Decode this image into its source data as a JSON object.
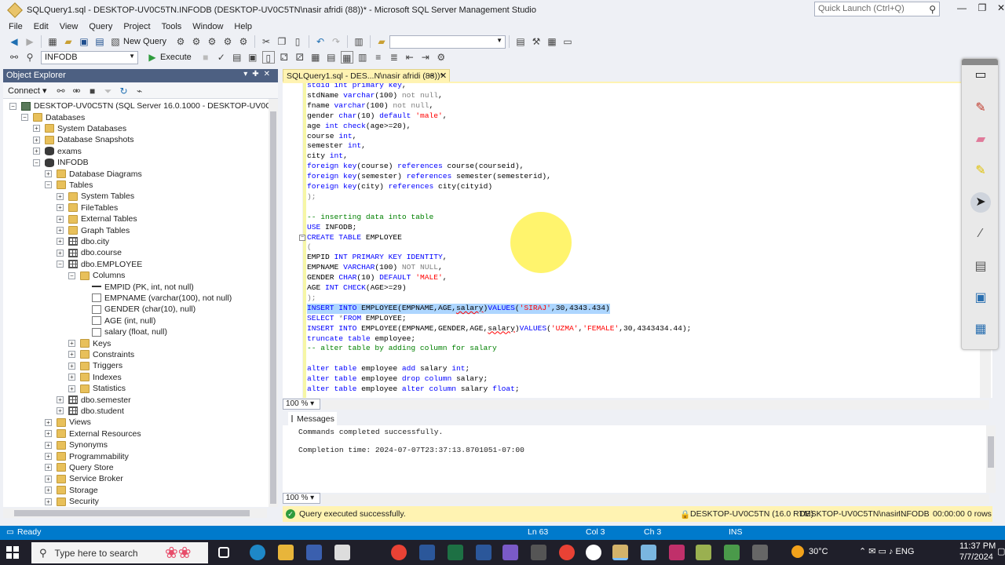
{
  "window": {
    "title": "SQLQuery1.sql - DESKTOP-UV0C5TN.INFODB (DESKTOP-UV0C5TN\\nasir afridi (88))* - Microsoft SQL Server Management Studio",
    "quick_launch_placeholder": "Quick Launch (Ctrl+Q)"
  },
  "menu": [
    "File",
    "Edit",
    "View",
    "Query",
    "Project",
    "Tools",
    "Window",
    "Help"
  ],
  "toolbar": {
    "new_query": "New Query",
    "database": "INFODB",
    "execute": "Execute"
  },
  "object_explorer": {
    "title": "Object Explorer",
    "connect": "Connect",
    "tree": [
      {
        "label": "DESKTOP-UV0C5TN (SQL Server 16.0.1000 - DESKTOP-UV0C5TN\\nasir a",
        "level": 0,
        "state": "-",
        "icon": "server"
      },
      {
        "label": "Databases",
        "level": 1,
        "state": "-",
        "icon": "folder"
      },
      {
        "label": "System Databases",
        "level": 2,
        "state": "+",
        "icon": "folder"
      },
      {
        "label": "Database Snapshots",
        "level": 2,
        "state": "+",
        "icon": "folder"
      },
      {
        "label": "exams",
        "level": 2,
        "state": "+",
        "icon": "db"
      },
      {
        "label": "INFODB",
        "level": 2,
        "state": "-",
        "icon": "db"
      },
      {
        "label": "Database Diagrams",
        "level": 3,
        "state": "+",
        "icon": "folder"
      },
      {
        "label": "Tables",
        "level": 3,
        "state": "-",
        "icon": "folder"
      },
      {
        "label": "System Tables",
        "level": 4,
        "state": "+",
        "icon": "folder"
      },
      {
        "label": "FileTables",
        "level": 4,
        "state": "+",
        "icon": "folder"
      },
      {
        "label": "External Tables",
        "level": 4,
        "state": "+",
        "icon": "folder"
      },
      {
        "label": "Graph Tables",
        "level": 4,
        "state": "+",
        "icon": "folder"
      },
      {
        "label": "dbo.city",
        "level": 4,
        "state": "+",
        "icon": "table"
      },
      {
        "label": "dbo.course",
        "level": 4,
        "state": "+",
        "icon": "table"
      },
      {
        "label": "dbo.EMPLOYEE",
        "level": 4,
        "state": "-",
        "icon": "table"
      },
      {
        "label": "Columns",
        "level": 5,
        "state": "-",
        "icon": "folder"
      },
      {
        "label": "EMPID (PK, int, not null)",
        "level": 6,
        "state": "",
        "icon": "key"
      },
      {
        "label": "EMPNAME (varchar(100), not null)",
        "level": 6,
        "state": "",
        "icon": "col"
      },
      {
        "label": "GENDER (char(10), null)",
        "level": 6,
        "state": "",
        "icon": "col"
      },
      {
        "label": "AGE (int, null)",
        "level": 6,
        "state": "",
        "icon": "col"
      },
      {
        "label": "salary (float, null)",
        "level": 6,
        "state": "",
        "icon": "col"
      },
      {
        "label": "Keys",
        "level": 5,
        "state": "+",
        "icon": "folder"
      },
      {
        "label": "Constraints",
        "level": 5,
        "state": "+",
        "icon": "folder"
      },
      {
        "label": "Triggers",
        "level": 5,
        "state": "+",
        "icon": "folder"
      },
      {
        "label": "Indexes",
        "level": 5,
        "state": "+",
        "icon": "folder"
      },
      {
        "label": "Statistics",
        "level": 5,
        "state": "+",
        "icon": "folder"
      },
      {
        "label": "dbo.semester",
        "level": 4,
        "state": "+",
        "icon": "table"
      },
      {
        "label": "dbo.student",
        "level": 4,
        "state": "+",
        "icon": "table"
      },
      {
        "label": "Views",
        "level": 3,
        "state": "+",
        "icon": "folder"
      },
      {
        "label": "External Resources",
        "level": 3,
        "state": "+",
        "icon": "folder"
      },
      {
        "label": "Synonyms",
        "level": 3,
        "state": "+",
        "icon": "folder"
      },
      {
        "label": "Programmability",
        "level": 3,
        "state": "+",
        "icon": "folder"
      },
      {
        "label": "Query Store",
        "level": 3,
        "state": "+",
        "icon": "folder"
      },
      {
        "label": "Service Broker",
        "level": 3,
        "state": "+",
        "icon": "folder"
      },
      {
        "label": "Storage",
        "level": 3,
        "state": "+",
        "icon": "folder"
      },
      {
        "label": "Security",
        "level": 3,
        "state": "+",
        "icon": "folder"
      }
    ]
  },
  "editor": {
    "tab_title": "SQLQuery1.sql - DES...N\\nasir afridi (88))*",
    "zoom": "100 %",
    "lines": [
      [
        [
          "kw",
          "stdid int primary key"
        ],
        [
          "",
          ","
        ]
      ],
      [
        [
          "",
          "stdName "
        ],
        [
          "kw",
          "varchar"
        ],
        [
          "",
          "(100) "
        ],
        [
          "gr",
          "not null"
        ],
        [
          "",
          ","
        ]
      ],
      [
        [
          "",
          "fname "
        ],
        [
          "kw",
          "varchar"
        ],
        [
          "",
          "(100) "
        ],
        [
          "gr",
          "not null"
        ],
        [
          "",
          ","
        ]
      ],
      [
        [
          "",
          "gender "
        ],
        [
          "kw",
          "char"
        ],
        [
          "",
          "(10) "
        ],
        [
          "kw",
          "default "
        ],
        [
          "str",
          "'male'"
        ],
        [
          "",
          ","
        ]
      ],
      [
        [
          "",
          "age "
        ],
        [
          "kw",
          "int check"
        ],
        [
          "",
          "(age>=20),"
        ]
      ],
      [
        [
          "",
          "course "
        ],
        [
          "kw",
          "int"
        ],
        [
          "",
          ","
        ]
      ],
      [
        [
          "",
          "semester "
        ],
        [
          "kw",
          "int"
        ],
        [
          "",
          ","
        ]
      ],
      [
        [
          "",
          "city "
        ],
        [
          "kw",
          "int"
        ],
        [
          "",
          ","
        ]
      ],
      [
        [
          "kw",
          "foreign key"
        ],
        [
          "",
          "(course) "
        ],
        [
          "kw",
          "references "
        ],
        [
          "",
          "course(courseid),"
        ]
      ],
      [
        [
          "kw",
          "foreign key"
        ],
        [
          "",
          "(semester) "
        ],
        [
          "kw",
          "references "
        ],
        [
          "",
          "semester(semesterid),"
        ]
      ],
      [
        [
          "kw",
          "foreign key"
        ],
        [
          "",
          "(city) "
        ],
        [
          "kw",
          "references "
        ],
        [
          "",
          "city(cityid)"
        ]
      ],
      [
        [
          "gr",
          ");"
        ]
      ],
      [
        [
          "",
          ""
        ]
      ],
      [
        [
          "cm",
          "-- inserting data into table"
        ]
      ],
      [
        [
          "kw",
          "USE "
        ],
        [
          "",
          "INFODB;"
        ]
      ],
      [
        [
          "kw",
          "CREATE TABLE "
        ],
        [
          "",
          "EMPLOYEE"
        ]
      ],
      [
        [
          "gr",
          "("
        ]
      ],
      [
        [
          "",
          "EMPID "
        ],
        [
          "kw",
          "INT PRIMARY KEY IDENTITY"
        ],
        [
          "",
          ","
        ]
      ],
      [
        [
          "",
          "EMPNAME "
        ],
        [
          "kw",
          "VARCHAR"
        ],
        [
          "",
          "(100) "
        ],
        [
          "gr",
          "NOT NULL"
        ],
        [
          "",
          ","
        ]
      ],
      [
        [
          "",
          "GENDER "
        ],
        [
          "kw",
          "CHAR"
        ],
        [
          "",
          "(10) "
        ],
        [
          "kw",
          "DEFAULT "
        ],
        [
          "str",
          "'MALE'"
        ],
        [
          "",
          ","
        ]
      ],
      [
        [
          "",
          "AGE "
        ],
        [
          "kw",
          "INT CHECK"
        ],
        [
          "",
          "(AGE>=29)"
        ]
      ],
      [
        [
          "gr",
          ");"
        ]
      ],
      [
        [
          "kw",
          "INSERT INTO "
        ],
        [
          "",
          "EMPLOYEE(EMPNAME,AGE,"
        ],
        [
          "squig",
          "salary"
        ],
        [
          "",
          ")"
        ],
        [
          "kw",
          "VALUES"
        ],
        [
          "",
          "("
        ],
        [
          "str",
          "'SIRAJ'"
        ],
        [
          "",
          ",30,4343.434)"
        ]
      ],
      [
        [
          "kw",
          "SELECT "
        ],
        [
          "gr",
          "*"
        ],
        [
          "kw",
          "FROM "
        ],
        [
          "",
          "EMPLOYEE;"
        ]
      ],
      [
        [
          "kw",
          "INSERT INTO "
        ],
        [
          "",
          "EMPLOYEE(EMPNAME,GENDER,AGE,"
        ],
        [
          "squig",
          "salary"
        ],
        [
          "",
          ")"
        ],
        [
          "kw",
          "VALUES"
        ],
        [
          "",
          "("
        ],
        [
          "str",
          "'UZMA'"
        ],
        [
          "",
          ","
        ],
        [
          "str",
          "'FEMALE'"
        ],
        [
          "",
          ",30,4343434.44);"
        ]
      ],
      [
        [
          "kw",
          "truncate table "
        ],
        [
          "",
          "employee;"
        ]
      ],
      [
        [
          "cm",
          "-- alter table by adding column for salary"
        ]
      ],
      [
        [
          "",
          ""
        ]
      ],
      [
        [
          "kw",
          "alter table "
        ],
        [
          "",
          "employee "
        ],
        [
          "kw",
          "add "
        ],
        [
          "",
          "salary "
        ],
        [
          "kw",
          "int"
        ],
        [
          "",
          ";"
        ]
      ],
      [
        [
          "kw",
          "alter table "
        ],
        [
          "",
          "employee "
        ],
        [
          "kw",
          "drop column "
        ],
        [
          "",
          "salary;"
        ]
      ],
      [
        [
          "kw",
          "alter table "
        ],
        [
          "",
          "employee "
        ],
        [
          "kw",
          "alter column "
        ],
        [
          "",
          "salary "
        ],
        [
          "kw",
          "float"
        ],
        [
          "",
          ";"
        ]
      ]
    ]
  },
  "results": {
    "tab": "Messages",
    "zoom": "100 %",
    "line1": "Commands completed successfully.",
    "line2": "Completion time: 2024-07-07T23:37:13.8701051-07:00"
  },
  "query_status": {
    "message": "Query executed successfully.",
    "server": "DESKTOP-UV0C5TN (16.0 RTM)",
    "user": "DESKTOP-UV0C5TN\\nasir ...",
    "db": "INFODB",
    "time": "00:00:00",
    "rows": "0 rows"
  },
  "statusbar": {
    "ready": "Ready",
    "ln": "Ln 63",
    "col": "Col 3",
    "ch": "Ch 3",
    "mode": "INS"
  },
  "taskbar": {
    "search_placeholder": "Type here to search",
    "temp": "30°C",
    "time": "11:37 PM",
    "date": "7/7/2024"
  },
  "colors": {
    "accent": "#007acc",
    "oe_header": "#4d6082",
    "tab_yellow": "#fff3b2"
  }
}
